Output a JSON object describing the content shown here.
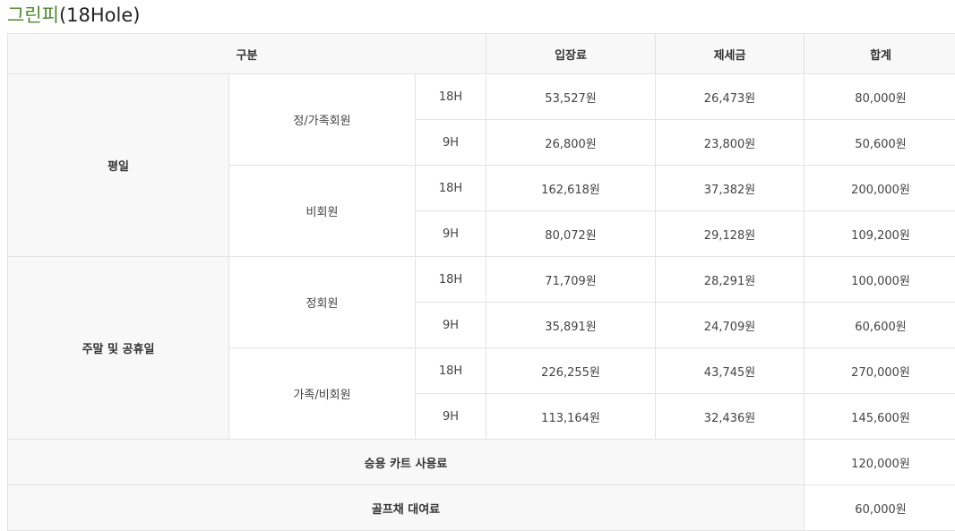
{
  "title": {
    "main": "그린피",
    "suffix": "(18Hole)"
  },
  "header": {
    "category": "구분",
    "entry_fee": "입장료",
    "tax": "제세금",
    "total": "합계"
  },
  "groups": [
    {
      "label": "평일",
      "members": [
        {
          "label": "정/가족회원",
          "rows": [
            {
              "hole": "18H",
              "entry": "53,527원",
              "tax": "26,473원",
              "total": "80,000원"
            },
            {
              "hole": "9H",
              "entry": "26,800원",
              "tax": "23,800원",
              "total": "50,600원"
            }
          ]
        },
        {
          "label": "비회원",
          "rows": [
            {
              "hole": "18H",
              "entry": "162,618원",
              "tax": "37,382원",
              "total": "200,000원"
            },
            {
              "hole": "9H",
              "entry": "80,072원",
              "tax": "29,128원",
              "total": "109,200원"
            }
          ]
        }
      ]
    },
    {
      "label": "주말 및 공휴일",
      "members": [
        {
          "label": "정회원",
          "rows": [
            {
              "hole": "18H",
              "entry": "71,709원",
              "tax": "28,291원",
              "total": "100,000원"
            },
            {
              "hole": "9H",
              "entry": "35,891원",
              "tax": "24,709원",
              "total": "60,600원"
            }
          ]
        },
        {
          "label": "가족/비회원",
          "rows": [
            {
              "hole": "18H",
              "entry": "226,255원",
              "tax": "43,745원",
              "total": "270,000원"
            },
            {
              "hole": "9H",
              "entry": "113,164원",
              "tax": "32,436원",
              "total": "145,600원"
            }
          ]
        }
      ]
    }
  ],
  "extras": [
    {
      "label": "승용 카트 사용료",
      "total": "120,000원"
    },
    {
      "label": "골프채 대여료",
      "total": "60,000원"
    }
  ],
  "colors": {
    "accent": "#4a8a2a",
    "header_bg": "#f8f8f8",
    "border": "#e3e3e3"
  }
}
